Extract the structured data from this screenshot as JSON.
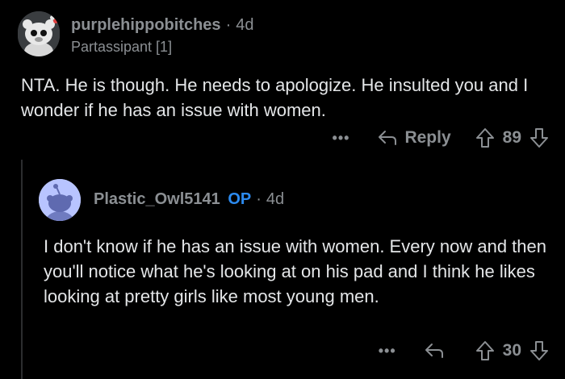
{
  "comment1": {
    "author": "purplehippobitches",
    "separator": "·",
    "time": "4d",
    "flair": "Partassipant [1]",
    "body": "NTA. He is though.  He needs to apologize.  He insulted you and I wonder if he has an issue with women.",
    "more": "•••",
    "reply_label": "Reply",
    "votes": "89"
  },
  "comment2": {
    "author": "Plastic_Owl5141",
    "op_badge": "OP",
    "separator": "·",
    "time": "4d",
    "body": "I don't know if he has an issue with women.  Every now and then you'll notice what he's looking at on his pad and I think he likes looking at pretty girls like most young men.",
    "more": "•••",
    "votes": "30"
  },
  "colors": {
    "background": "#000000",
    "text": "#e4e6e8",
    "muted": "#8b8f93",
    "op_blue": "#2c8bf0",
    "avatar2_bg": "#b8c4ff"
  }
}
